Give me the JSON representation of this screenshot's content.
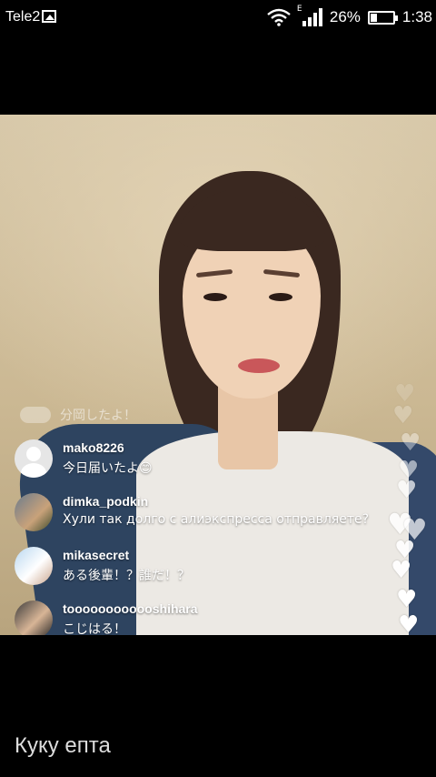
{
  "status_bar": {
    "carrier": "Tele2",
    "network_type": "E",
    "battery_percent": "26%",
    "battery_level": 0.26,
    "time": "1:38",
    "icons": [
      "gallery-icon",
      "wifi-icon",
      "signal-icon",
      "battery-icon"
    ]
  },
  "live": {
    "faded_comment": "分岡したよ！",
    "comments": [
      {
        "username": "mako8226",
        "message": "今日届いたよ😊",
        "avatar": "placeholder"
      },
      {
        "username": "dimka_podkin",
        "message": "Хули так долго с алиэкспресса отправляете?",
        "avatar": "photo"
      },
      {
        "username": "mikasecret",
        "message": "ある後輩！？誰だ！？",
        "avatar": "photo"
      },
      {
        "username": "toooooooooooshihara",
        "message": "こじはる！",
        "avatar": "photo"
      }
    ],
    "heart_color": "#ffffff"
  },
  "caption": "Куку епта"
}
